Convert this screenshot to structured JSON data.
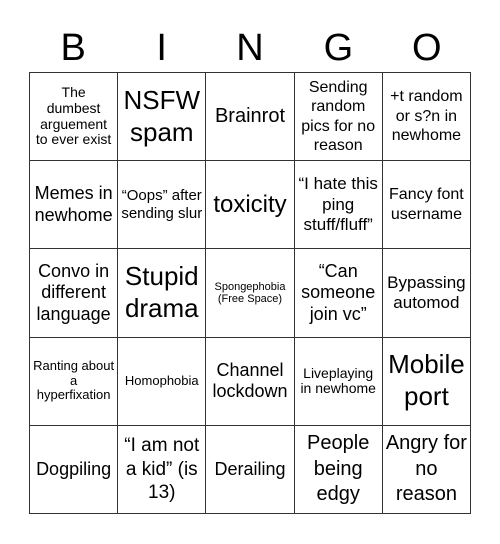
{
  "header": {
    "letters": [
      "B",
      "I",
      "N",
      "G",
      "O"
    ]
  },
  "board": {
    "cells": [
      "The dumbest arguement to ever exist",
      "NSFW spam",
      "Brainrot",
      "Sending random pics for no reason",
      "+t random or s?n in newhome",
      "Memes in newhome",
      "“Oops” after sending slur",
      "toxicity",
      "“I hate this ping stuff/fluff”",
      "Fancy font username",
      "Convo in different language",
      "Stupid drama",
      "Spongephobia (Free Space)",
      "“Can someone join vc”",
      "Bypassing automod",
      "Ranting about a hyperfixation",
      "Homophobia",
      "Channel lockdown",
      "Liveplaying in newhome",
      "Mobile port",
      "Dogpiling",
      "“I am not a kid” (is 13)",
      "Derailing",
      "People being edgy",
      "Angry for no reason"
    ],
    "free_space_index": 12
  }
}
